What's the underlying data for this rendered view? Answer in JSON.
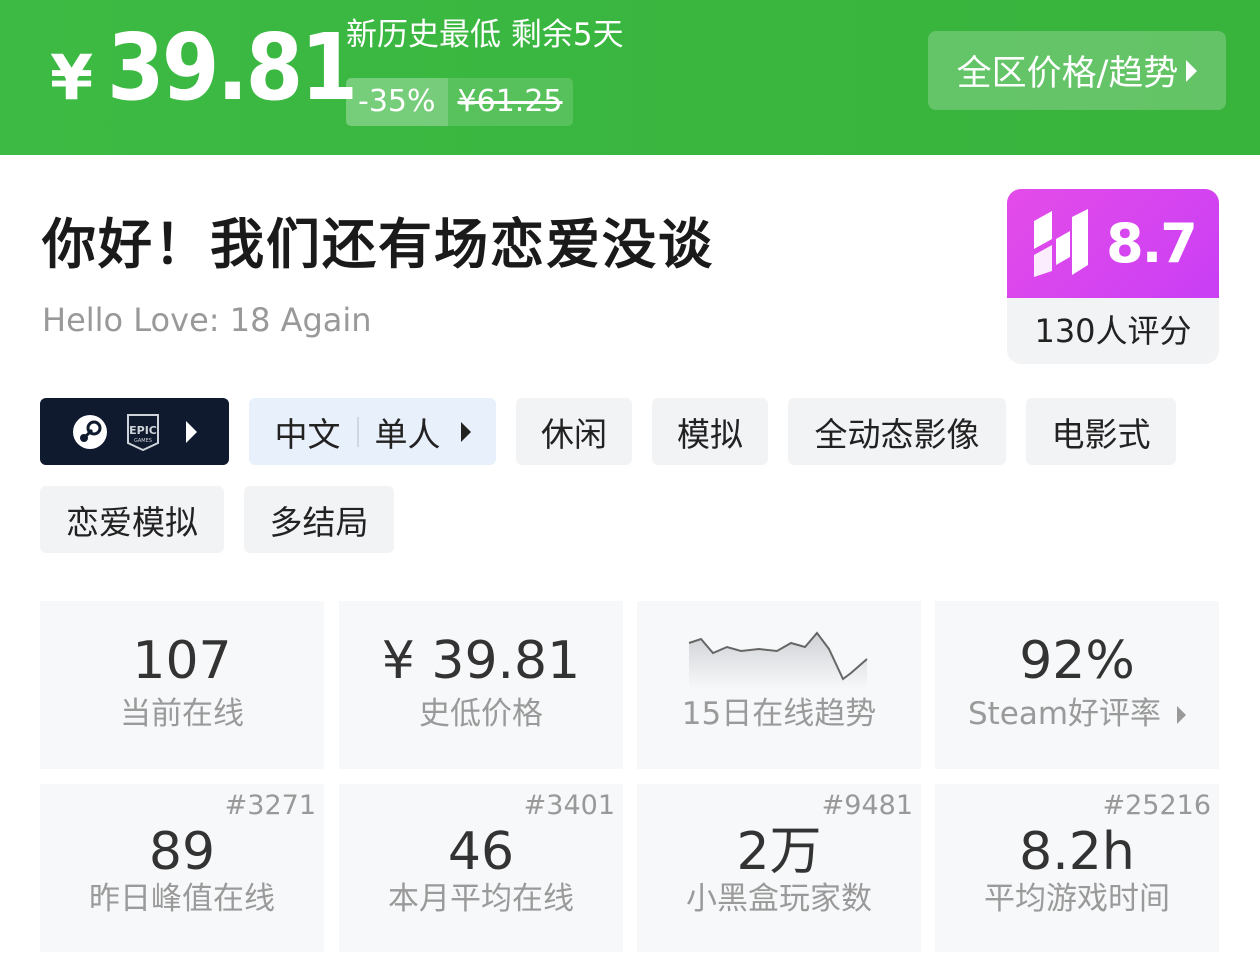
{
  "banner": {
    "currency": "¥",
    "price": "39.81",
    "deal_text": "新历史最低 剩余5天",
    "discount": "-35%",
    "original_price": "¥61.25",
    "region_button": "全区价格/趋势"
  },
  "game": {
    "title_cn": "你好！我们还有场恋爱没谈",
    "title_en": "Hello Love: 18 Again"
  },
  "score": {
    "value": "8.7",
    "count_label": "130人评分",
    "accent": "#d845ef"
  },
  "tags": {
    "platform_icons": [
      "steam-icon",
      "epic-games-icon"
    ],
    "language": "中文",
    "mode": "单人",
    "genres": [
      "休闲",
      "模拟",
      "全动态影像",
      "电影式",
      "恋爱模拟",
      "多结局"
    ]
  },
  "stats": {
    "online": {
      "value": "107",
      "label": "当前在线"
    },
    "lowest_price": {
      "value": "¥ 39.81",
      "label": "史低价格"
    },
    "trend": {
      "label": "15日在线趋势"
    },
    "steam_rating": {
      "value": "92%",
      "label": "Steam好评率"
    },
    "peak_yesterday": {
      "value": "89",
      "label": "昨日峰值在线",
      "rank": "#3271"
    },
    "monthly_avg": {
      "value": "46",
      "label": "本月平均在线",
      "rank": "#3401"
    },
    "players": {
      "value": "2万",
      "label": "小黑盒玩家数",
      "rank": "#9481"
    },
    "avg_playtime": {
      "value": "8.2h",
      "label": "平均游戏时间",
      "rank": "#25216"
    }
  },
  "colors": {
    "banner_green": "#3cba43",
    "platform_bg": "#0f1a2e",
    "language_bg": "#e8f0fb",
    "tag_bg": "#f2f3f5",
    "stat_bg": "#f7f8f9"
  }
}
